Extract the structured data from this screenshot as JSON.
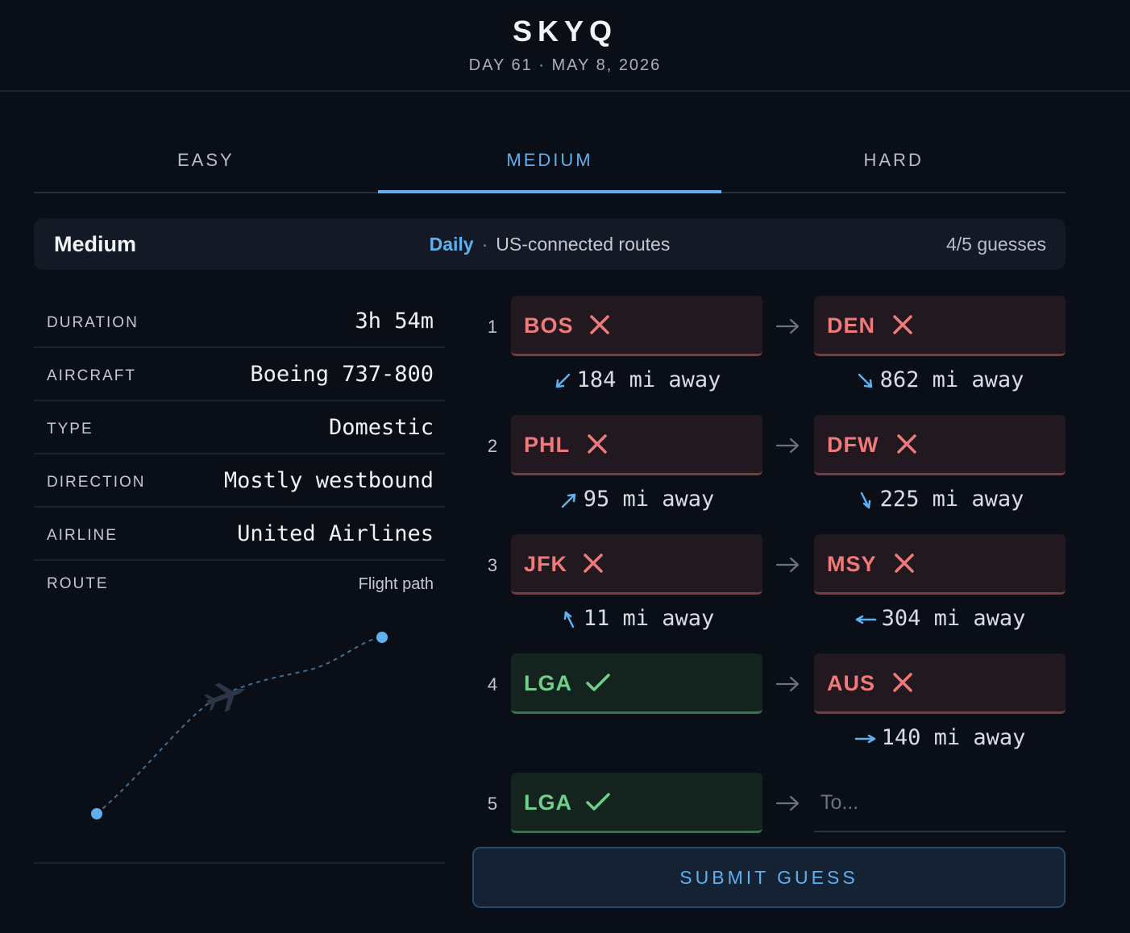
{
  "app": {
    "title": "SKYQ",
    "subtitle": "DAY 61 · MAY 8, 2026"
  },
  "tabs": [
    {
      "label": "EASY",
      "active": false
    },
    {
      "label": "MEDIUM",
      "active": true
    },
    {
      "label": "HARD",
      "active": false
    }
  ],
  "mode": {
    "name": "Medium",
    "daily": "Daily",
    "separator": "·",
    "description": "US-connected routes",
    "guesses": "4/5 guesses"
  },
  "info": {
    "duration": {
      "label": "DURATION",
      "value": "3h 54m"
    },
    "aircraft": {
      "label": "AIRCRAFT",
      "value": "Boeing 737-800"
    },
    "type": {
      "label": "TYPE",
      "value": "Domestic"
    },
    "direction": {
      "label": "DIRECTION",
      "value": "Mostly westbound"
    },
    "airline": {
      "label": "AIRLINE",
      "value": "United Airlines"
    },
    "route": {
      "label": "ROUTE",
      "value": "Flight path"
    }
  },
  "guesses": [
    {
      "num": "1",
      "from": {
        "code": "BOS",
        "correct": false,
        "dist": "184 mi away",
        "bearing": "southwest"
      },
      "to": {
        "code": "DEN",
        "correct": false,
        "dist": "862 mi away",
        "bearing": "southeast"
      }
    },
    {
      "num": "2",
      "from": {
        "code": "PHL",
        "correct": false,
        "dist": "95 mi away",
        "bearing": "northeast"
      },
      "to": {
        "code": "DFW",
        "correct": false,
        "dist": "225 mi away",
        "bearing": "south-southeast"
      }
    },
    {
      "num": "3",
      "from": {
        "code": "JFK",
        "correct": false,
        "dist": "11 mi away",
        "bearing": "north-northwest"
      },
      "to": {
        "code": "MSY",
        "correct": false,
        "dist": "304 mi away",
        "bearing": "west"
      }
    },
    {
      "num": "4",
      "from": {
        "code": "LGA",
        "correct": true
      },
      "to": {
        "code": "AUS",
        "correct": false,
        "dist": "140 mi away",
        "bearing": "east"
      }
    }
  ],
  "current": {
    "num": "5",
    "from": {
      "code": "LGA",
      "correct": true
    },
    "to_placeholder": "To..."
  },
  "submit_label": "SUBMIT GUESS",
  "colors": {
    "background": "#0a0e17",
    "accent": "#5fb0ee",
    "wrong": "#f07a7a",
    "correct": "#6ed08a"
  }
}
